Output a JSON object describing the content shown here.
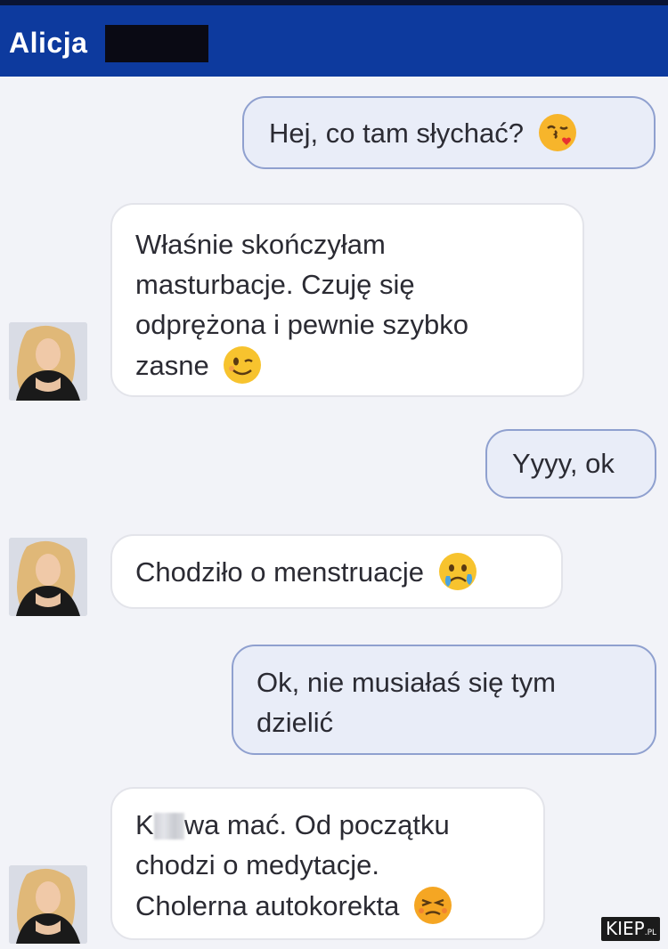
{
  "header": {
    "contact_name": "Alicja"
  },
  "messages": {
    "m1": {
      "direction": "outgoing",
      "text": "Hej, co tam słychać?",
      "emoji": "kissing-face-icon"
    },
    "m2": {
      "direction": "incoming",
      "line1": "Właśnie skończyłam",
      "line2": "masturbacje. Czuję się",
      "line3": "odprężona i pewnie szybko",
      "line4": "zasne",
      "emoji": "winking-face-icon"
    },
    "m3": {
      "direction": "outgoing",
      "text": "Yyyy, ok"
    },
    "m4": {
      "direction": "incoming",
      "text": "Chodziło o menstruacje",
      "emoji": "sad-face-icon"
    },
    "m5": {
      "direction": "outgoing",
      "line1": "Ok, nie musiałaś się tym",
      "line2": "dzielić"
    },
    "m6": {
      "direction": "incoming",
      "line1_start": "K",
      "line1_end": "wa mać. Od początku",
      "line2": "chodzi o medytacje.",
      "line3": "Cholerna autokorekta",
      "emoji": "persevering-face-icon"
    }
  },
  "watermark": {
    "brand": "KIEP",
    "suffix": ".PL"
  },
  "colors": {
    "header_bg": "#0d3a9e",
    "outgoing_bubble": "#e9edf8",
    "outgoing_border": "#8fa0cf",
    "incoming_bubble": "#ffffff",
    "background": "#f2f3f8"
  }
}
